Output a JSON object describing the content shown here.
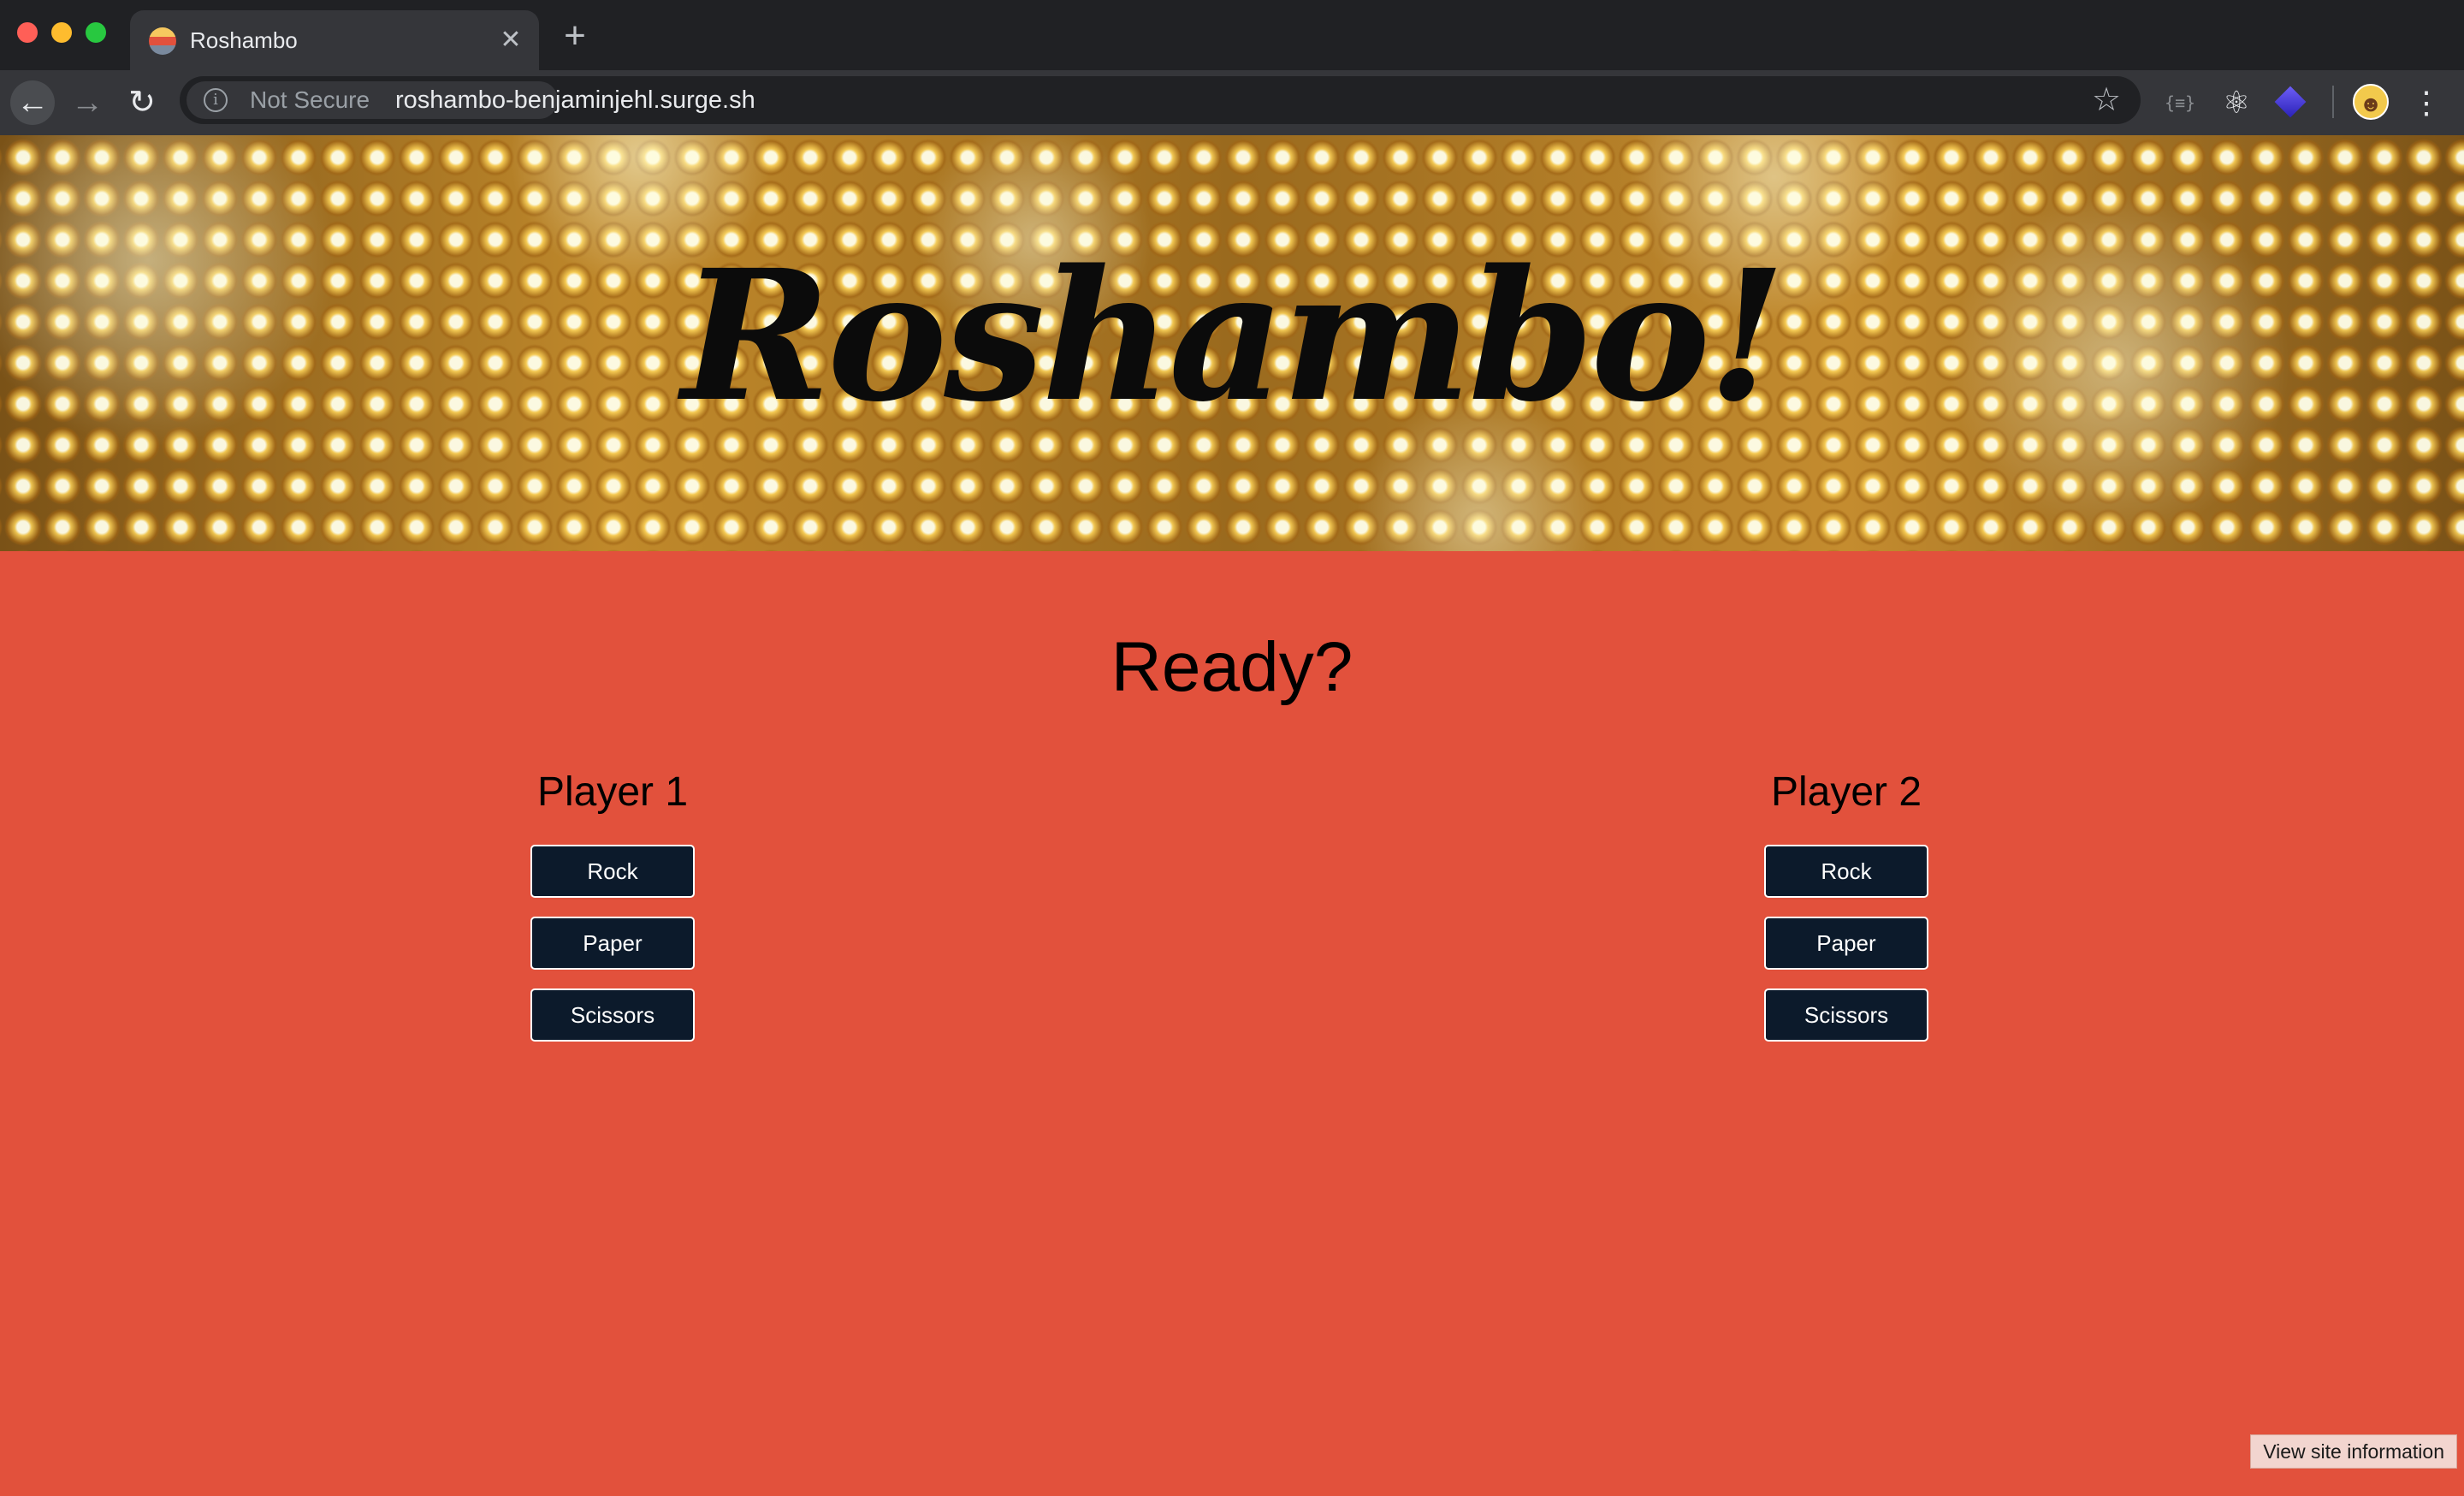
{
  "browser": {
    "tab": {
      "title": "Roshambo",
      "close_glyph": "✕",
      "favicon": "roshambo-favicon"
    },
    "new_tab_glyph": "+",
    "nav": {
      "back": "←",
      "forward": "→",
      "reload": "↻"
    },
    "omnibox": {
      "security_label": "Not Secure",
      "info_glyph": "i",
      "url": "roshambo-benjaminjehl.surge.sh",
      "star_glyph": "☆"
    },
    "extensions": {
      "json_viewer": "{≡}",
      "react_devtools": "⚛",
      "stack": ""
    },
    "avatar_glyph": "☻",
    "menu_glyph": "⋮",
    "traffic_lights": {
      "close": "#ff5f57",
      "minimize": "#febc2e",
      "zoom": "#28c840"
    }
  },
  "page": {
    "hero_title": "Roshambo!",
    "prompt": "Ready?",
    "players": [
      {
        "name": "Player 1",
        "choices": [
          "Rock",
          "Paper",
          "Scissors"
        ]
      },
      {
        "name": "Player 2",
        "choices": [
          "Rock",
          "Paper",
          "Scissors"
        ]
      }
    ],
    "status_tooltip": "View site information"
  },
  "colors": {
    "page_background": "#e2513c",
    "button_background": "#0c1a2b",
    "button_text": "#ffffff"
  }
}
